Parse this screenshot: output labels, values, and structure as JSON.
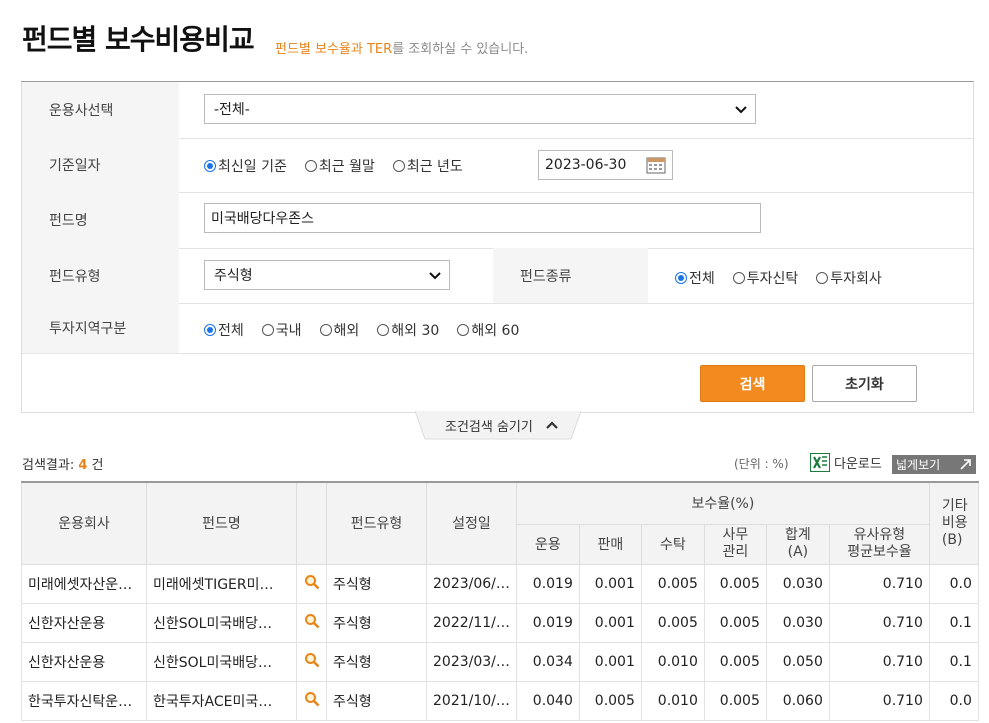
{
  "header": {
    "title": "펀드별 보수비용비교",
    "subtitle_highlight": "펀드별 보수율과 TER",
    "subtitle_rest": "를 조회하실 수 있습니다."
  },
  "form": {
    "company_label": "운용사선택",
    "company_value": "-전체-",
    "date_label": "기준일자",
    "date_options": [
      "최신일 기준",
      "최근 월말",
      "최근 년도"
    ],
    "date_selected": 0,
    "date_value": "2023-06-30",
    "fund_name_label": "펀드명",
    "fund_name_value": "미국배당다우존스",
    "fund_type_label": "펀드유형",
    "fund_type_value": "주식형",
    "fund_kind_label": "펀드종류",
    "fund_kind_options": [
      "전체",
      "투자신탁",
      "투자회사"
    ],
    "fund_kind_selected": 0,
    "region_label": "투자지역구분",
    "region_options": [
      "전체",
      "국내",
      "해외",
      "해외 30",
      "해외 60"
    ],
    "region_selected": 0,
    "search_button": "검색",
    "reset_button": "초기화",
    "toggle_label": "조건검색 숨기기"
  },
  "results": {
    "label": "검색결과",
    "count": "4",
    "unit_suffix": "건",
    "unit_note": "(단위 : %)",
    "download_label": "다운로드",
    "wide_view_label": "넓게보기"
  },
  "table": {
    "headers": {
      "company": "운용회사",
      "fund_name": "펀드명",
      "fund_type": "펀드유형",
      "setup_date": "설정일",
      "fee_group": "보수율(%)",
      "mgmt": "운용",
      "sales": "판매",
      "trust": "수탁",
      "admin": "사무\n관리",
      "total": "합계\n(A)",
      "peer_avg": "유사유형\n평균보수율",
      "other": "기타\n비용\n(B)"
    },
    "rows": [
      {
        "company": "미래에셋자산운…",
        "fund": "미래에셋TIGER미…",
        "type": "주식형",
        "date": "2023/06/…",
        "mgmt": "0.019",
        "sales": "0.001",
        "trust": "0.005",
        "admin": "0.005",
        "total": "0.030",
        "peer": "0.710",
        "other": "0.0"
      },
      {
        "company": "신한자산운용",
        "fund": "신한SOL미국배당…",
        "type": "주식형",
        "date": "2022/11/…",
        "mgmt": "0.019",
        "sales": "0.001",
        "trust": "0.005",
        "admin": "0.005",
        "total": "0.030",
        "peer": "0.710",
        "other": "0.1"
      },
      {
        "company": "신한자산운용",
        "fund": "신한SOL미국배당…",
        "type": "주식형",
        "date": "2023/03/…",
        "mgmt": "0.034",
        "sales": "0.001",
        "trust": "0.010",
        "admin": "0.005",
        "total": "0.050",
        "peer": "0.710",
        "other": "0.1"
      },
      {
        "company": "한국투자신탁운…",
        "fund": "한국투자ACE미국…",
        "type": "주식형",
        "date": "2021/10/…",
        "mgmt": "0.040",
        "sales": "0.005",
        "trust": "0.010",
        "admin": "0.005",
        "total": "0.060",
        "peer": "0.710",
        "other": "0.0"
      }
    ]
  },
  "colors": {
    "accent": "#f28a1f",
    "radio": "#1a73e8"
  }
}
